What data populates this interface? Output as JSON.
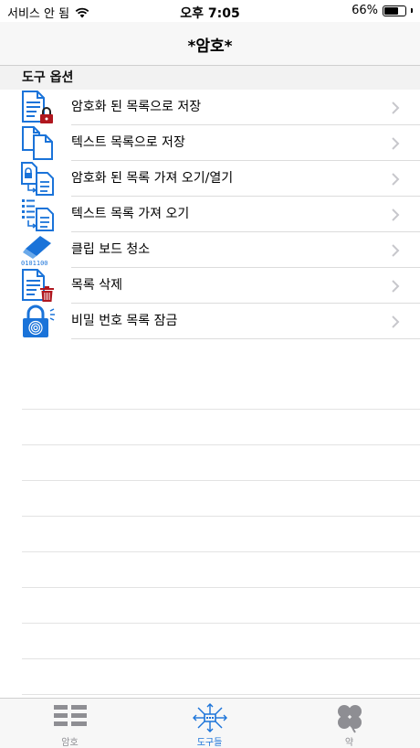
{
  "status_bar": {
    "carrier": "서비스 안 됨",
    "time": "오후 7:05",
    "battery_text": "66%",
    "battery_level": 0.66
  },
  "nav": {
    "title": "*암호*"
  },
  "section": {
    "header": "도구 옵션"
  },
  "tools": [
    {
      "label": "암호화 된 목록으로 저장",
      "icon": "encrypted-doc-lock-icon"
    },
    {
      "label": "텍스트 목록으로 저장",
      "icon": "copy-docs-icon"
    },
    {
      "label": "암호화 된 목록 가져 오기/열기",
      "icon": "import-encrypted-doc-icon"
    },
    {
      "label": "텍스트 목록 가져 오기",
      "icon": "import-text-list-icon"
    },
    {
      "label": "클립 보드 청소",
      "icon": "eraser-binary-icon",
      "icon_text": "0101100"
    },
    {
      "label": "목록 삭제",
      "icon": "doc-trash-icon"
    },
    {
      "label": "비밀 번호 목록 잠금",
      "icon": "fingerprint-lock-icon"
    }
  ],
  "tab_bar": {
    "tabs": [
      {
        "label": "암호",
        "icon": "list-grid-icon",
        "active": false
      },
      {
        "label": "도구들",
        "icon": "tools-network-icon",
        "active": true
      },
      {
        "label": "약",
        "icon": "clover-icon",
        "active": false
      }
    ]
  },
  "colors": {
    "accent": "#1a73d9",
    "lock_red": "#b0171f",
    "inactive": "#8e8e93"
  }
}
